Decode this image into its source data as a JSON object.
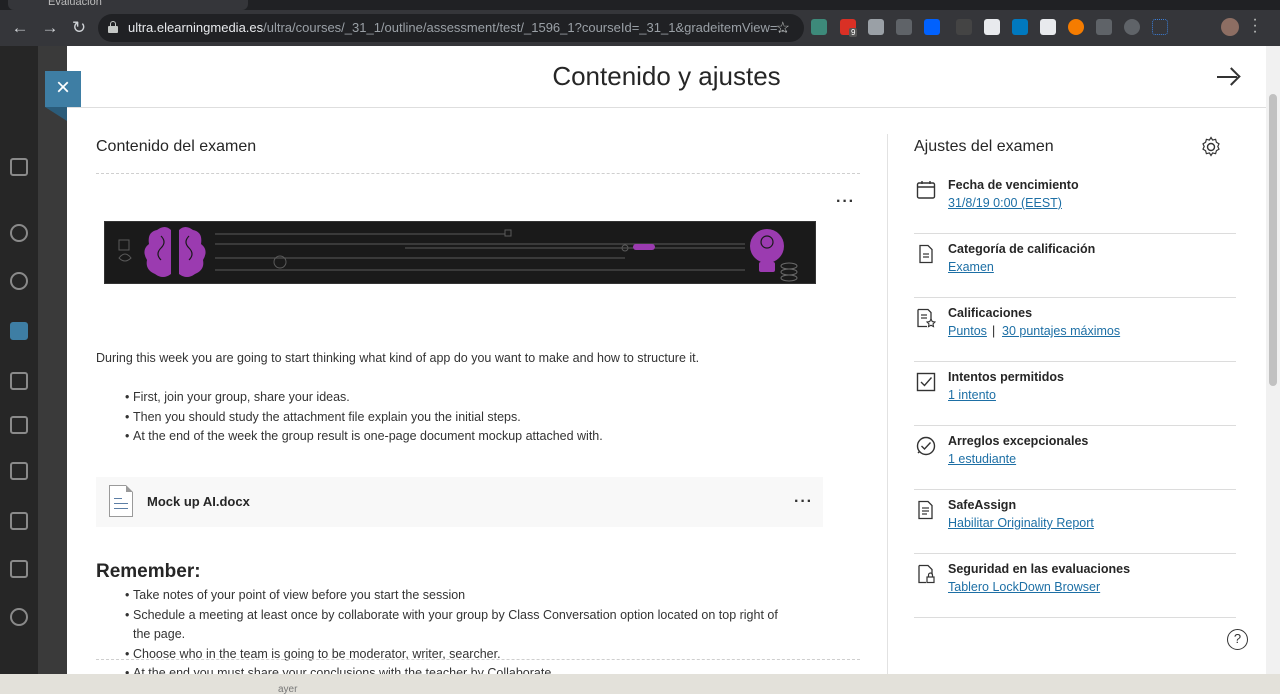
{
  "browser": {
    "tab_title": "Evaluación",
    "url_host": "ultra.elearningmedia.es",
    "url_path": "/ultra/courses/_31_1/outline/assessment/test/_1596_1?courseId=_31_1&gradeitemView=...",
    "ext_badge": "9"
  },
  "background": {
    "bottom_text": "ayer"
  },
  "panel": {
    "title": "Contenido y ajustes"
  },
  "content": {
    "section_title": "Contenido del examen",
    "intro": "During this week you are going to start thinking what kind of app do you want to make and how to structure it.",
    "bullets": [
      "First, join your group, share your ideas.",
      "Then you should study the attachment file explain you the initial steps.",
      "At the end of the week the group result is one-page document mockup attached with."
    ],
    "attachment": {
      "name": "Mock up AI.docx"
    },
    "remember_title": "Remember:",
    "remember_bullets": [
      "Take notes of your point of view before you start the session",
      "Schedule a meeting at least once by collaborate with your group by Class Conversation option located on top right of",
      "the page.",
      "Choose who in the team is going to be moderator, writer, searcher.",
      "At the end you must share your conclusions with the teacher by Collaborate."
    ]
  },
  "settings": {
    "title": "Ajustes del examen",
    "items": [
      {
        "label": "Fecha de vencimiento",
        "value": "31/8/19 0:00 (EEST)",
        "icon": "calendar-icon"
      },
      {
        "label": "Categoría de calificación",
        "value": "Examen",
        "icon": "document-icon"
      },
      {
        "label": "Calificaciones",
        "value": "Puntos",
        "value2": "30 puntajes máximos",
        "separator": "|",
        "icon": "grading-icon"
      },
      {
        "label": "Intentos permitidos",
        "value": "1 intento",
        "icon": "checkbox-icon"
      },
      {
        "label": "Arreglos excepcionales",
        "value": "1 estudiante",
        "icon": "accommodation-icon"
      },
      {
        "label": "SafeAssign",
        "value": "Habilitar Originality Report",
        "icon": "safeassign-icon"
      },
      {
        "label": "Seguridad en las evaluaciones",
        "value": "Tablero LockDown Browser",
        "icon": "lock-document-icon"
      }
    ]
  },
  "help": {
    "symbol": "?"
  },
  "colors": {
    "accent": "#3e7ea4",
    "link": "#1d6fa5",
    "banner_purple": "#9b3bb0"
  }
}
